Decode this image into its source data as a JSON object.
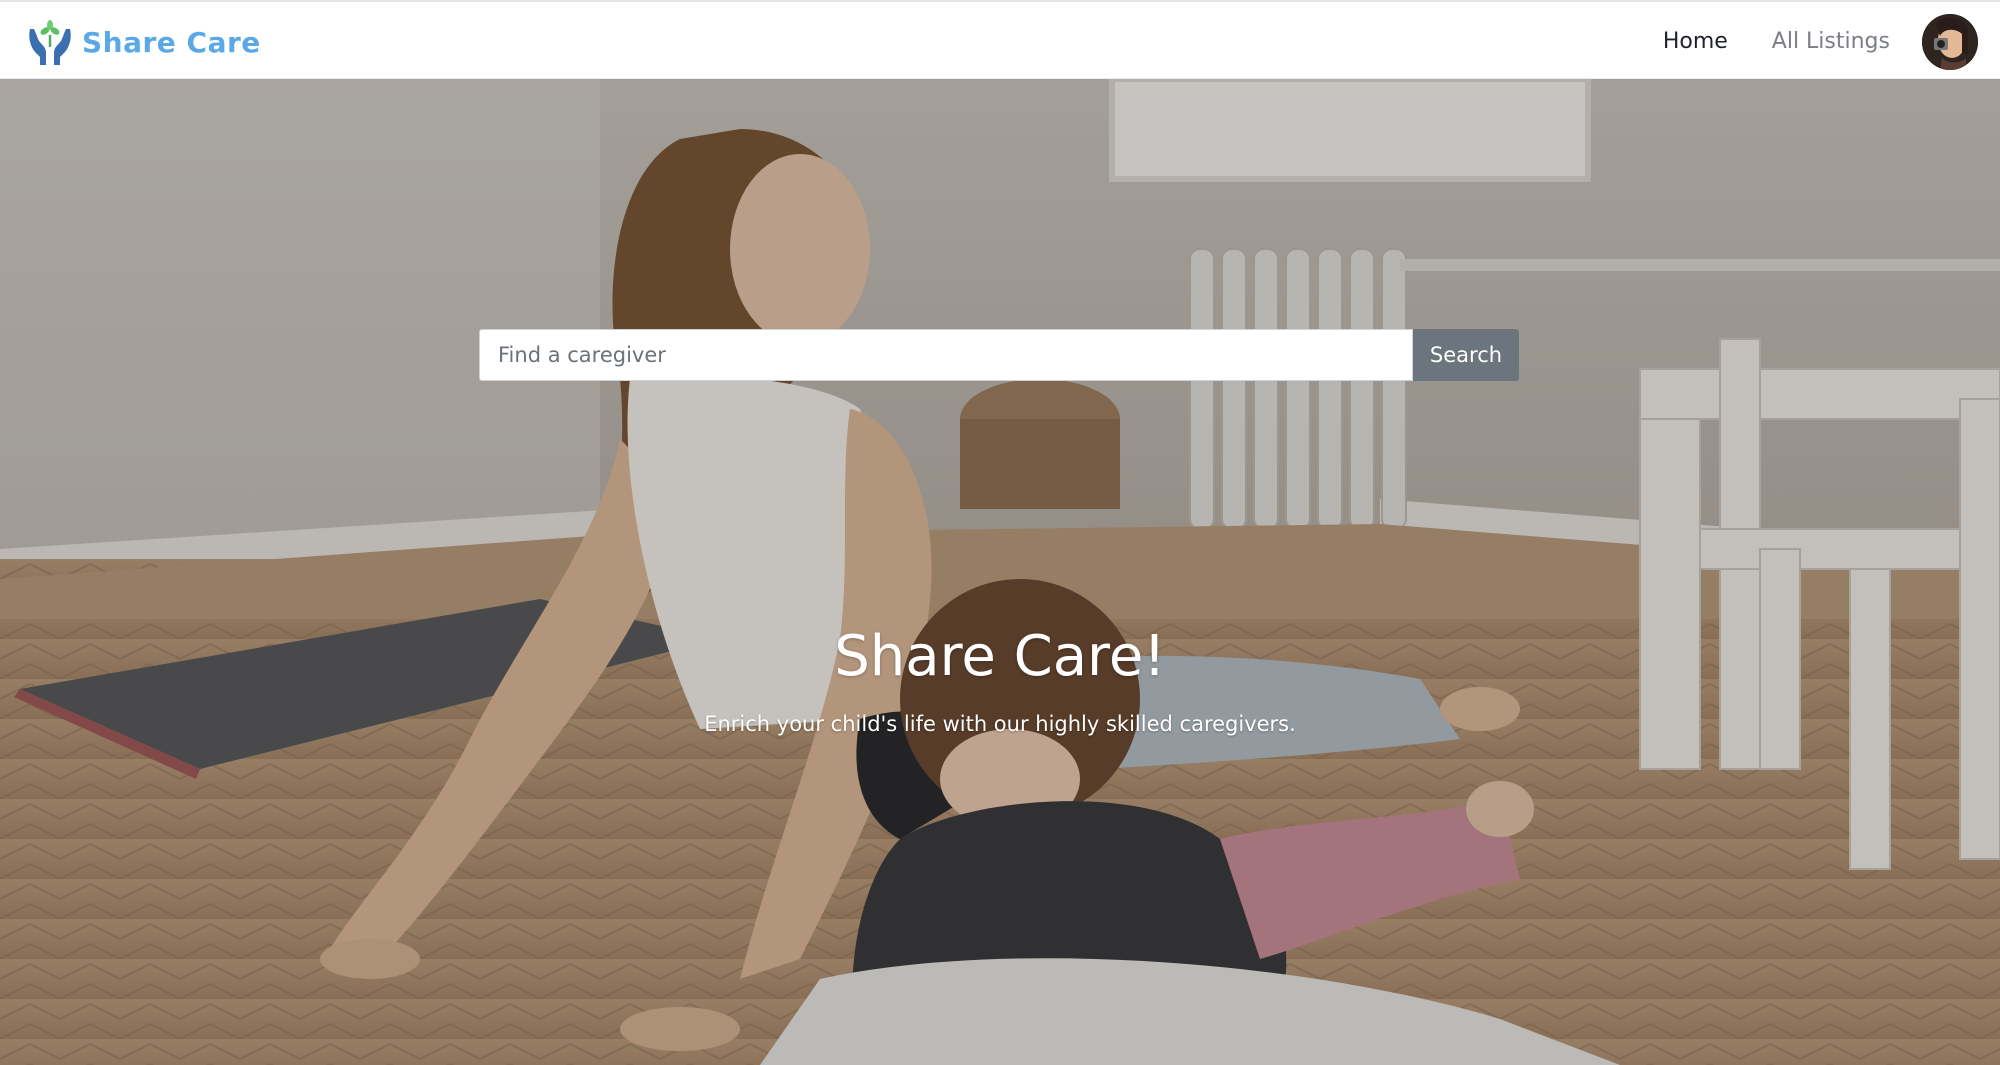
{
  "navbar": {
    "brand_name": "Share Care",
    "brand_color": "#5aa9e6",
    "logo_icon": "hands-sprout-icon",
    "links": [
      {
        "label": "Home",
        "active": true
      },
      {
        "label": "All Listings",
        "active": false
      }
    ],
    "avatar_icon": "user-avatar"
  },
  "hero": {
    "search": {
      "placeholder": "Find a caregiver",
      "value": "",
      "button_label": "Search",
      "button_color": "#6c757d"
    },
    "title": "Share Care!",
    "subtitle": "Enrich your child's life with our highly skilled caregivers."
  }
}
